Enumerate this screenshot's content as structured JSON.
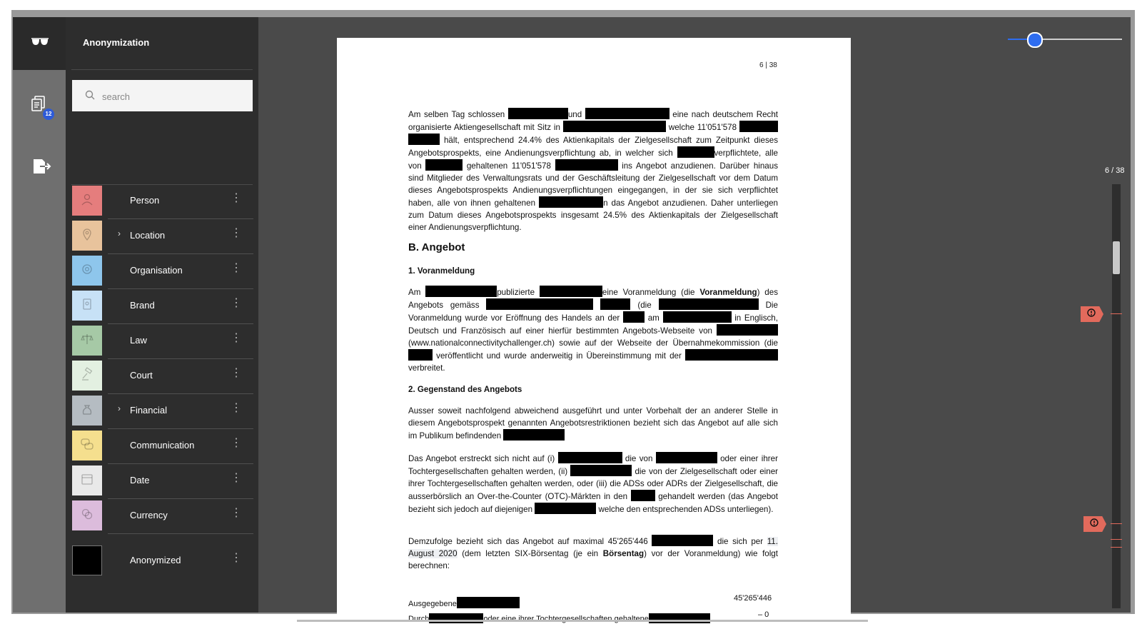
{
  "app": {
    "title": "Anonymization"
  },
  "rail": {
    "badge_count": "12"
  },
  "search": {
    "placeholder": "search"
  },
  "categories": [
    {
      "label": "Person",
      "color": "#e57d7d",
      "icon": "person-icon",
      "expandable": false
    },
    {
      "label": "Location",
      "color": "#e8c39c",
      "icon": "location-pin-icon",
      "expandable": true
    },
    {
      "label": "Organisation",
      "color": "#8ec6ec",
      "icon": "organisation-icon",
      "expandable": false
    },
    {
      "label": "Brand",
      "color": "#c7e1f6",
      "icon": "brand-icon",
      "expandable": false
    },
    {
      "label": "Law",
      "color": "#a6c9a6",
      "icon": "scales-icon",
      "expandable": false
    },
    {
      "label": "Court",
      "color": "#e3f0e1",
      "icon": "gavel-icon",
      "expandable": false
    },
    {
      "label": "Financial",
      "color": "#b5bcc2",
      "icon": "money-bag-icon",
      "expandable": true
    },
    {
      "label": "Communication",
      "color": "#f5df8e",
      "icon": "chat-bubbles-icon",
      "expandable": false
    },
    {
      "label": "Date",
      "color": "#e9e9e9",
      "icon": "calendar-icon",
      "expandable": false
    },
    {
      "label": "Currency",
      "color": "#dcbcdc",
      "icon": "coins-icon",
      "expandable": false
    },
    {
      "label": "Anonymized",
      "color": "#000000",
      "icon": "",
      "expandable": false
    }
  ],
  "viewer": {
    "page_indicator": "6 / 38",
    "zoom_fraction": 0.24
  },
  "document": {
    "page_number": "6 | 38",
    "p1": {
      "a": "Am selben Tag schlossen",
      "b": "und",
      "c": "eine nach deutschem Recht organisierte Aktiengesellschaft mit Sitz in",
      "d": "welche 11'051'578",
      "e": "hält, entsprechend 24.4% des Aktienkapitals der Zielgesellschaft zum Zeitpunkt dieses Angebotsprospekts, eine Andienungsverpflichtung ab, in welcher sich",
      "f": "verpflichtete, alle von",
      "g": "gehaltenen 11'051'578",
      "h": "ins Angebot anzudienen. Darüber hinaus sind Mitglieder des Verwaltungsrats und der Geschäftsleitung der Zielgesellschaft vor dem Datum dieses Angebotsprospekts Andienungsverpflichtungen eingegangen, in der sie sich verpflichtet haben, alle von ihnen gehaltenen",
      "i": "n das Angebot anzudienen. Daher unterliegen zum Datum dieses Angebotsprospekts insgesamt 24.5% des Aktienkapitals der Zielgesellschaft einer Andienungsverpflichtung."
    },
    "heading_b": "B.   Angebot",
    "heading_1": "1.     Voranmeldung",
    "p2": {
      "a": "Am",
      "b": "publizierte",
      "c": "eine Voranmeldung (die",
      "bold": "Voranmeldung",
      "d": ") des Angebots gemäss",
      "e": "(die",
      "f": "Die Voranmeldung wurde vor Eröffnung des Handels an der",
      "g": "am",
      "h": "in Englisch, Deutsch und Französisch auf einer hierfür bestimmten Angebots-Webseite von",
      "i": "(www.nationalconnectivitychallenger.ch) sowie auf der Webseite der Übernahmekommission (die",
      "j": "veröffentlicht und wurde anderweitig in Übereinstimmung mit der",
      "k": "verbreitet."
    },
    "heading_2": "2.     Gegenstand des Angebots",
    "p3": {
      "a": "Ausser soweit nachfolgend abweichend ausgeführt und unter Vorbehalt der an anderer Stelle in diesem Angebotsprospekt genannten Angebotsrestriktionen bezieht sich das Angebot auf alle sich im Publikum befindenden"
    },
    "p4": {
      "a": "Das Angebot erstreckt sich nicht auf (i)",
      "b": "die von",
      "c": "oder einer ihrer Tochtergesellschaften gehalten werden, (ii)",
      "d": "die von der Zielgesellschaft oder einer ihrer Tochtergesellschaften gehalten werden, oder (iii) die ADSs oder ADRs der Zielgesellschaft, die ausserbörslich an Over-the-Counter (OTC)-Märkten in den",
      "e": "gehandelt werden (das Angebot bezieht sich jedoch auf diejenigen",
      "f": "welche den entsprechenden ADSs unterliegen)."
    },
    "p5": {
      "a": "Demzufolge bezieht sich das Angebot auf maximal 45'265'446",
      "b": "die sich per",
      "date_hl": "11. August 2020",
      "c": "(dem letzten SIX-Börsentag (je ein",
      "bold": "Börsentag",
      "d": ") vor der Voranmeldung) wie folgt berechnen:"
    },
    "row1": {
      "label": "Ausgegebene",
      "value": "45'265'446"
    },
    "row2": {
      "label_a": "Durch",
      "label_b": "oder eine ihrer Tochtergesellschaften gehaltene",
      "value": "– 0"
    }
  }
}
